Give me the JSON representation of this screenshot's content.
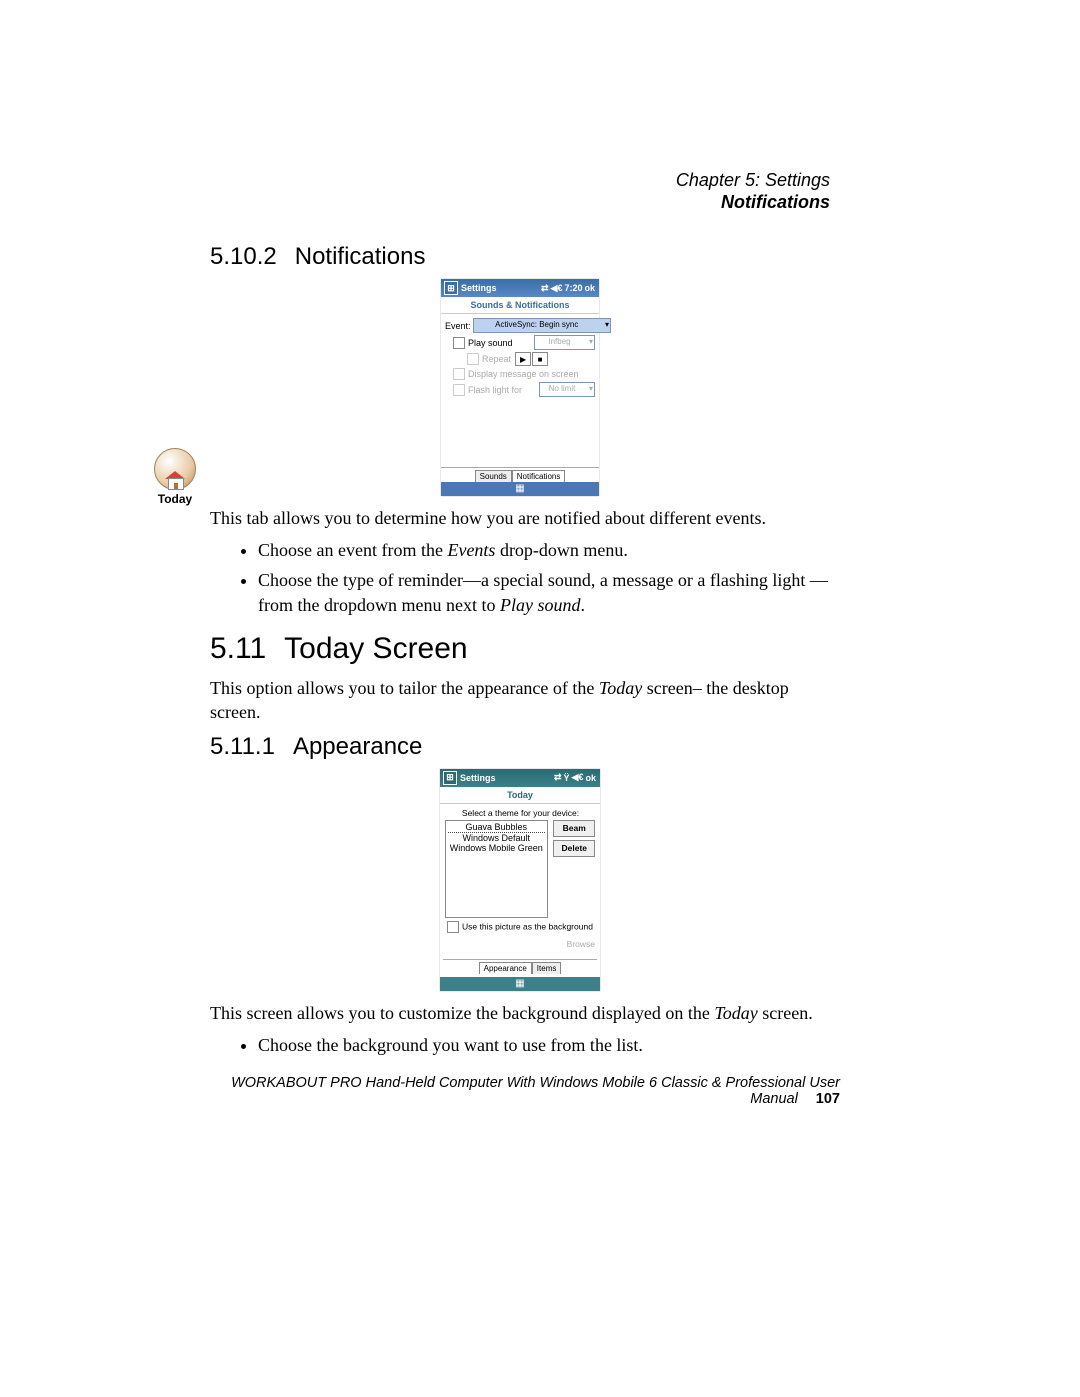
{
  "header": {
    "chapter": "Chapter 5:  Settings",
    "section": "Notifications"
  },
  "s1": {
    "num": "5.10.2",
    "title": "Notifications"
  },
  "fig1": {
    "title": "Settings",
    "time": "7:20",
    "ok": "ok",
    "subheader": "Sounds & Notifications",
    "event_label": "Event:",
    "event_value": "ActiveSync: Begin sync",
    "play_sound": "Play sound",
    "sound_value": "Infbeg",
    "repeat": "Repeat",
    "display_msg": "Display message on screen",
    "flash_label": "Flash light for",
    "flash_value": "No limit",
    "tab1": "Sounds",
    "tab2": "Notifications"
  },
  "p1": "This tab allows you to determine how you are notified about different events.",
  "b1": {
    "pre": "Choose an event from the ",
    "em": "Events",
    "post": " drop-down menu."
  },
  "b2": {
    "pre": "Choose the type of reminder—a special sound, a message or a flashing light —from the dropdown menu next to ",
    "em": "Play sound",
    "post": "."
  },
  "today_icon": "Today",
  "s2": {
    "num": "5.11",
    "title": "Today Screen"
  },
  "p2": {
    "pre": "This option allows you to tailor the appearance of the ",
    "em": "Today",
    "post": " screen– the desktop screen."
  },
  "s3": {
    "num": "5.11.1",
    "title": "Appearance"
  },
  "fig2": {
    "title": "Settings",
    "ok": "ok",
    "subheader": "Today",
    "instr": "Select a theme for your device:",
    "theme1": "Guava Bubbles",
    "theme2": "Windows Default",
    "theme3": "Windows Mobile Green",
    "beam": "Beam",
    "delete": "Delete",
    "use_bg": "Use this picture as the background",
    "browse": "Browse",
    "tab1": "Appearance",
    "tab2": "Items"
  },
  "p3": {
    "pre": "This screen allows you to customize the background displayed on the ",
    "em": "Today",
    "post": " screen."
  },
  "b3": "Choose the background you want to use from the list.",
  "footer": {
    "text": "WORKABOUT PRO Hand-Held Computer With Windows Mobile 6 Classic & Professional User Manual",
    "page": "107"
  }
}
